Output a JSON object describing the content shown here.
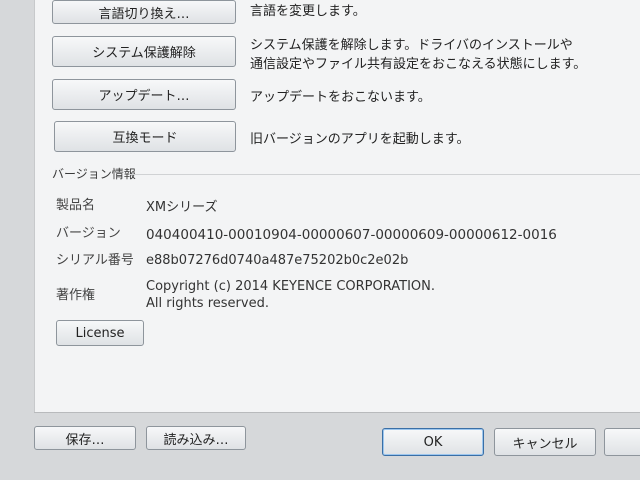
{
  "actions": [
    {
      "button": "言語切り換え…",
      "desc": [
        "言語を変更します。"
      ]
    },
    {
      "button": "システム保護解除",
      "desc": [
        "システム保護を解除します。ドライバのインストールや",
        "通信設定やファイル共有設定をおこなえる状態にします。"
      ]
    },
    {
      "button": "アップデート…",
      "desc": [
        "アップデートをおこないます。"
      ]
    },
    {
      "button": "互換モード",
      "desc": [
        "旧バージョンのアプリを起動します。"
      ]
    }
  ],
  "version_info": {
    "title": "バージョン情報",
    "product_label": "製品名",
    "product_value": "XMシリーズ",
    "version_label": "バージョン",
    "version_value": "040400410-00010904-00000607-00000609-00000612-0016",
    "serial_label": "シリアル番号",
    "serial_value": "e88b07276d0740a487e75202b0c2e02b",
    "copyright_label": "著作権",
    "copyright_line1": "Copyright (c) 2014 KEYENCE CORPORATION.",
    "copyright_line2": "All rights reserved.",
    "license_button": "License"
  },
  "footer": {
    "save": "保存…",
    "load": "読み込み…",
    "ok": "OK",
    "cancel": "キャンセル"
  }
}
